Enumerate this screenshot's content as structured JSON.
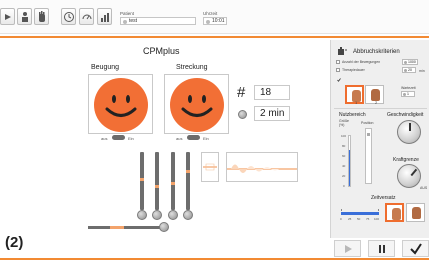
{
  "toolbar": {
    "patient_label": "Patient",
    "patient_value": "test",
    "time_label": "Uhrzeit",
    "time_value": "10:01"
  },
  "main": {
    "title": "CPMplus",
    "beugung_label": "Beugung",
    "streckung_label": "Streckung",
    "toggle_off_label": "aus",
    "toggle_on_label": "Ein",
    "repetition_symbol": "#",
    "repetition_value": "18",
    "duration_value": "2 min",
    "figure_label": "(2)"
  },
  "panel": {
    "title": "Abbruchskriterien",
    "crit_1_label": "Anzahl der Bewegungen",
    "crit_1_value": "1000",
    "crit_2_label": "Therapiedauer",
    "crit_2_value": "20",
    "crit_2_unit": "min",
    "wartezeit_label": "Wartezeit",
    "wartezeit_value": "1",
    "nutzbereich_label": "Nutzbereich",
    "groesse_label": "Größe",
    "groesse_unit": "(%)",
    "position_label": "Position",
    "geschwindigkeit_label": "Geschwindigkeit",
    "kraftgrenze_label": "Kraftgrenze",
    "kraft_aus_label": "AUS",
    "zeitversatz_label": "Zeitversatz",
    "scale_ticks": [
      "100",
      "80",
      "60",
      "40",
      "20",
      "0"
    ],
    "zeit_ticks": [
      "0",
      "25",
      "50",
      "75",
      "100"
    ],
    "hand_1_num": "1",
    "hand_2_num": "2"
  },
  "footer": {
    "play_icon": "play-icon",
    "pause_icon": "pause-icon",
    "confirm_icon": "check-icon"
  },
  "colors": {
    "accent": "#f26f35",
    "line": "#f28a33",
    "panel_bg": "#efefef"
  },
  "levels": {
    "kraftgrenze_checkbox_checked": true,
    "nutzbereich_fill_fraction": 0.7
  }
}
